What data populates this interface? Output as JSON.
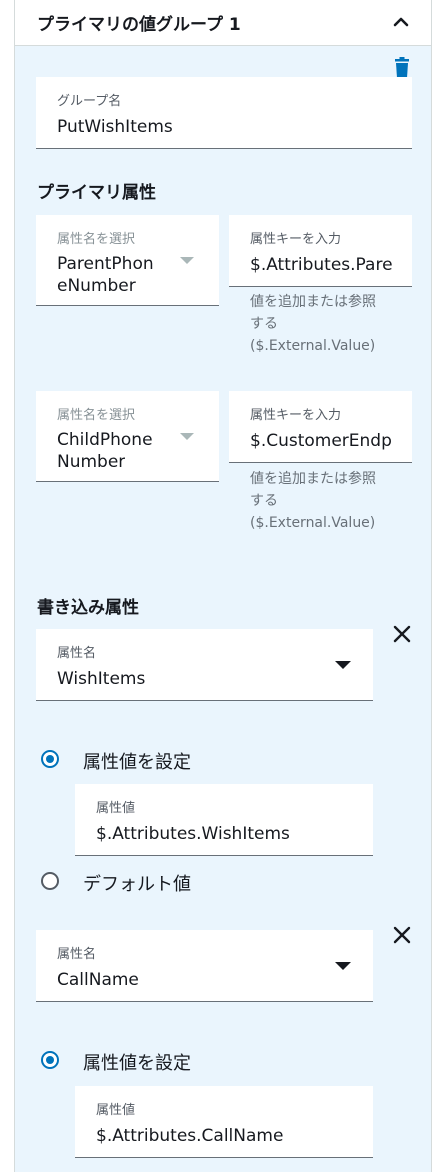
{
  "group": {
    "title": "プライマリの値グループ 1",
    "group_name_label": "グループ名",
    "group_name_value": "PutWishItems"
  },
  "primary_attributes": {
    "title": "プライマリ属性",
    "rows": [
      {
        "name_label": "属性名を選択",
        "name_value_line1": "ParentPhon",
        "name_value_line2": "eNumber",
        "key_label": "属性キーを入力",
        "key_value": "$.Attributes.Pare",
        "hint_line1": "値を追加または参照",
        "hint_line2": "する",
        "hint_line3": "($.External.Value)"
      },
      {
        "name_label": "属性名を選択",
        "name_value_line1": "ChildPhone",
        "name_value_line2": "Number",
        "key_label": "属性キーを入力",
        "key_value": "$.CustomerEndp",
        "hint_line1": "値を追加または参照",
        "hint_line2": "する",
        "hint_line3": "($.External.Value)"
      }
    ]
  },
  "write_attributes": {
    "title": "書き込み属性",
    "items": [
      {
        "name_label": "属性名",
        "name_value": "WishItems",
        "radio_set_label": "属性値を設定",
        "value_label": "属性値",
        "value_value": "$.Attributes.WishItems",
        "radio_default_label": "デフォルト値"
      },
      {
        "name_label": "属性名",
        "name_value": "CallName",
        "radio_set_label": "属性値を設定",
        "value_label": "属性値",
        "value_value": "$.Attributes.CallName"
      }
    ]
  },
  "icons": {
    "collapse": "chevron-up-icon",
    "delete": "trash-icon",
    "remove": "close-icon",
    "dropdown": "caret-down-icon"
  },
  "colors": {
    "panel_background": "#eaf5fd",
    "accent": "#0073bb",
    "delete_icon": "#0073bb"
  }
}
